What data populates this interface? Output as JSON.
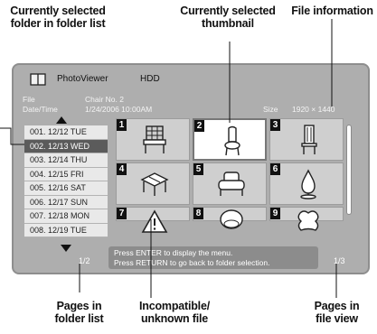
{
  "callouts": {
    "folder_selected": [
      "Currently selected",
      "folder in folder list"
    ],
    "thumb_selected": [
      "Currently selected",
      "thumbnail"
    ],
    "file_info": [
      "File information"
    ],
    "pages_folder": [
      "Pages in",
      "folder list"
    ],
    "incompatible": [
      "Incompatible/",
      "unknown file"
    ],
    "pages_file": [
      "Pages in",
      "file view"
    ]
  },
  "screen": {
    "app_title": "PhotoViewer",
    "source": "HDD",
    "file_label": "File",
    "file_value": "Chair No. 2",
    "datetime_label": "Date/Time",
    "datetime_value": "1/24/2006 10:00AM",
    "size_label": "Size",
    "size_value": "1920 × 1440",
    "folders": [
      "001. 12/12 TUE",
      "002. 12/13 WED",
      "003. 12/14 THU",
      "004. 12/15 FRI",
      "005. 12/16 SAT",
      "006. 12/17 SUN",
      "007. 12/18 MON",
      "008. 12/19 TUE"
    ],
    "folder_page": "1/2",
    "file_page": "1/3",
    "thumbnails": [
      {
        "num": "1",
        "icon": "chair-icon"
      },
      {
        "num": "2",
        "icon": "chair-icon"
      },
      {
        "num": "3",
        "icon": "chair-icon"
      },
      {
        "num": "4",
        "icon": "table-icon"
      },
      {
        "num": "5",
        "icon": "armchair-icon"
      },
      {
        "num": "6",
        "icon": "lamp-icon"
      },
      {
        "num": "7",
        "icon": "warning-icon"
      },
      {
        "num": "8",
        "icon": "chair-icon"
      },
      {
        "num": "9",
        "icon": "stool-icon"
      }
    ],
    "message_1": "Press ENTER to display the menu.",
    "message_2": "Press RETURN to go back to folder selection."
  }
}
